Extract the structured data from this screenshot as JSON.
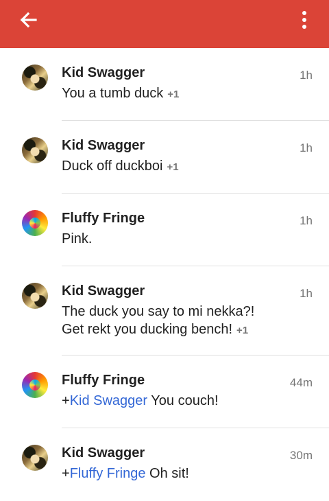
{
  "appbar": {
    "back_icon": "arrow-back-icon",
    "menu_icon": "more-vert-icon",
    "color": "#db4437"
  },
  "comments": [
    {
      "author": "Kid Swagger",
      "time": "1h",
      "lines": [
        "You a tumb duck"
      ],
      "plus": "+1",
      "avatar": "kid-swagger"
    },
    {
      "author": "Kid Swagger",
      "time": "1h",
      "lines": [
        "Duck off duckboi"
      ],
      "plus": "+1",
      "avatar": "kid-swagger"
    },
    {
      "author": "Fluffy Fringe",
      "time": "1h",
      "lines": [
        "Pink."
      ],
      "plus": "",
      "avatar": "fluffy-fringe"
    },
    {
      "author": "Kid Swagger",
      "time": "1h",
      "lines": [
        "The duck you say to mi nekka?!",
        "Get rekt you ducking bench!"
      ],
      "plus": "+1",
      "avatar": "kid-swagger"
    },
    {
      "author": "Fluffy Fringe",
      "time": "44m",
      "prefix": "+",
      "mention": "Kid Swagger",
      "text": " You couch!",
      "avatar": "fluffy-fringe"
    },
    {
      "author": "Kid Swagger",
      "time": "30m",
      "prefix": "+",
      "mention": "Fluffy Fringe",
      "text": " Oh sit!",
      "avatar": "kid-swagger"
    }
  ],
  "colors": {
    "mention": "#3367d6",
    "secondary_text": "#757575"
  }
}
